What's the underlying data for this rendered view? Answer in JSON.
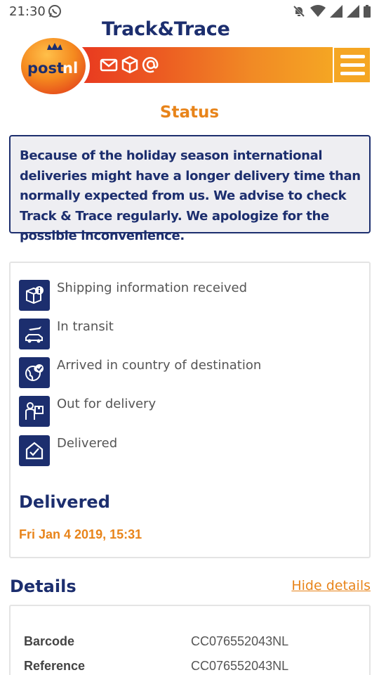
{
  "status_bar": {
    "time": "21:30"
  },
  "header": {
    "title": "Track&Trace",
    "logo_text": "postnl",
    "menu_icon": "hamburger-icon",
    "brand_color": "#f18a25",
    "navy_color": "#1c2e6e"
  },
  "page": {
    "section_title": "Status"
  },
  "notice": {
    "text": "Because of the holiday season international deliveries might have a longer delivery time than normally expected from us. We advise to check Track & Trace regularly. We apologize for the possible inconvenience."
  },
  "status": {
    "steps": [
      {
        "label": "Shipping information received",
        "icon": "package-info-icon"
      },
      {
        "label": "In transit",
        "icon": "plane-van-icon"
      },
      {
        "label": "Arrived in country of destination",
        "icon": "globe-check-icon"
      },
      {
        "label": "Out for delivery",
        "icon": "courier-icon"
      },
      {
        "label": "Delivered",
        "icon": "house-check-icon"
      }
    ],
    "current_status": "Delivered",
    "delivered_at": "Fri Jan 4 2019, 15:31"
  },
  "details": {
    "heading": "Details",
    "hide_link": "Hide details",
    "rows": [
      {
        "key": "Barcode",
        "value": "CC076552043NL"
      },
      {
        "key": "Reference",
        "value": "CC076552043NL"
      }
    ]
  }
}
